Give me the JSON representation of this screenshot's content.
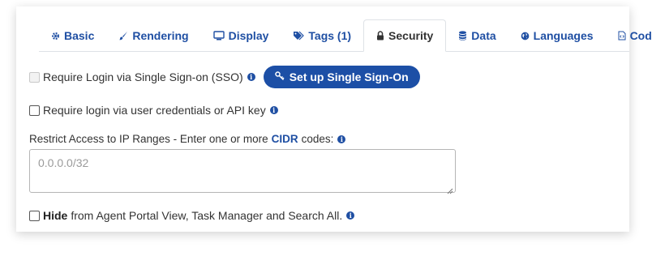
{
  "tabs": [
    {
      "label": "Basic",
      "icon": "gear-icon"
    },
    {
      "label": "Rendering",
      "icon": "brush-icon"
    },
    {
      "label": "Display",
      "icon": "monitor-icon"
    },
    {
      "label": "Tags (1)",
      "icon": "tags-icon"
    },
    {
      "label": "Security",
      "icon": "lock-icon",
      "active": true
    },
    {
      "label": "Data",
      "icon": "database-icon"
    },
    {
      "label": "Languages",
      "icon": "globe-icon"
    },
    {
      "label": "Code",
      "icon": "code-file-icon"
    }
  ],
  "security": {
    "sso_label": "Require Login via Single Sign-on (SSO)",
    "sso_checked": false,
    "sso_disabled": true,
    "sso_button": "Set up Single Sign-On",
    "credentials_label": "Require login via user credentials or API key",
    "credentials_checked": false,
    "ip_label_prefix": "Restrict Access to IP Ranges - Enter one or more",
    "ip_link": "CIDR",
    "ip_label_suffix": "codes:",
    "ip_placeholder": "0.0.0.0/32",
    "ip_value": "",
    "hide_bold": "Hide",
    "hide_label": "from Agent Portal View, Task Manager and Search All.",
    "hide_checked": false
  },
  "colors": {
    "accent": "#1f4fa3",
    "button": "#1c4fa6"
  }
}
